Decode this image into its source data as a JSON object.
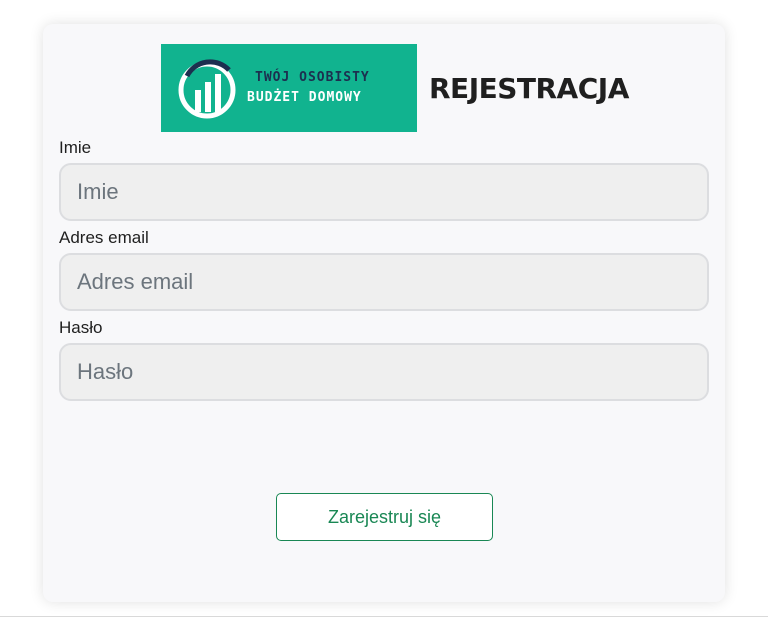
{
  "logo": {
    "line1": "TWÓJ OSOBISTY",
    "line2": "BUDŻET DOMOWY",
    "background": "#11b38f",
    "icon": "bar-chart-icon"
  },
  "title": "REJESTRACJA",
  "form": {
    "name": {
      "label": "Imie",
      "placeholder": "Imie"
    },
    "email": {
      "label": "Adres email",
      "placeholder": "Adres email"
    },
    "password": {
      "label": "Hasło",
      "placeholder": "Hasło"
    },
    "submit_label": "Zarejestruj się"
  },
  "colors": {
    "accent": "#198754",
    "card_background": "#f8f8fa",
    "input_background": "#efefef"
  }
}
